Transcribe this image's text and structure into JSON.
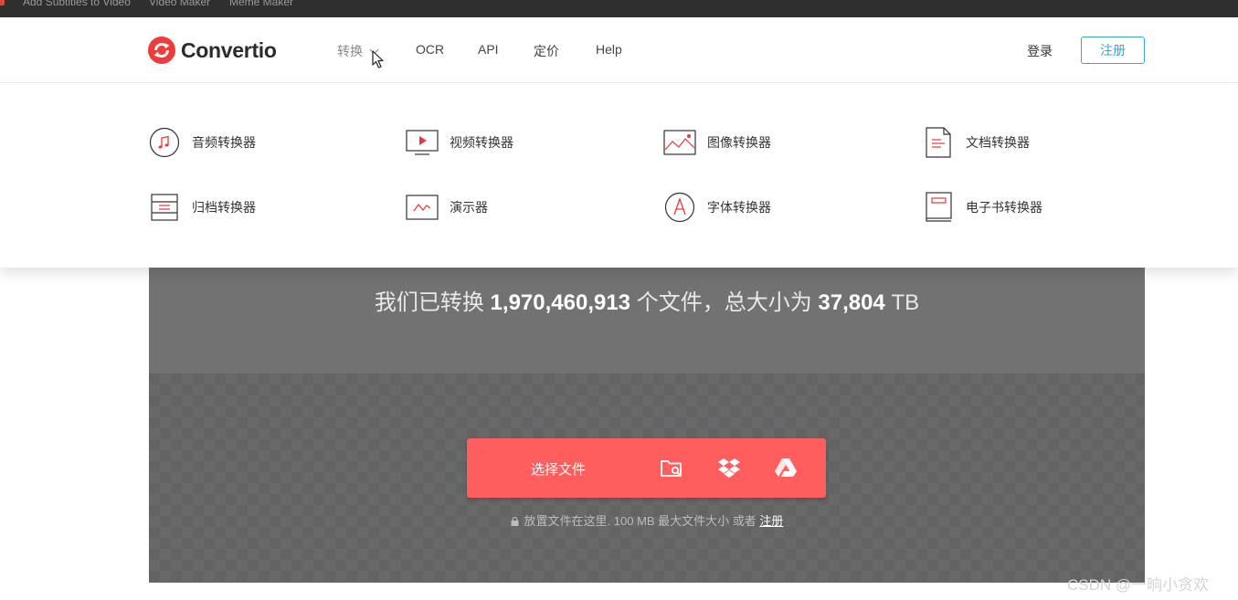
{
  "bookmarks": [
    "Add Subtitles to Video",
    "Video Maker",
    "Meme Maker"
  ],
  "header": {
    "logo_text": "Convertio",
    "nav": {
      "convert": "转换",
      "ocr": "OCR",
      "api": "API",
      "pricing": "定价",
      "help": "Help"
    },
    "login": "登录",
    "register": "注册"
  },
  "dropdown": {
    "items": [
      {
        "label": "音频转换器",
        "icon": "audio-icon"
      },
      {
        "label": "视频转换器",
        "icon": "video-icon"
      },
      {
        "label": "图像转换器",
        "icon": "image-icon"
      },
      {
        "label": "文档转换器",
        "icon": "document-icon"
      },
      {
        "label": "归档转换器",
        "icon": "archive-icon"
      },
      {
        "label": "演示器",
        "icon": "presentation-icon"
      },
      {
        "label": "字体转换器",
        "icon": "font-icon"
      },
      {
        "label": "电子书转换器",
        "icon": "ebook-icon"
      }
    ]
  },
  "stats": {
    "prefix": "我们已转换",
    "file_count": "1,970,460,913",
    "middle": "个文件，总大小为",
    "total_size": "37,804",
    "unit": "TB"
  },
  "upload": {
    "choose_label": "选择文件",
    "hint": "放置文件在这里. 100 MB 最大文件大小 或者",
    "hint_link": "注册"
  },
  "watermark": "CSDN @一晌小贪欢",
  "colors": {
    "brand_red": "#ff5e5e",
    "accent_blue": "#35a7d6",
    "hero_gray": "#727272",
    "upload_gray": "#636363"
  }
}
